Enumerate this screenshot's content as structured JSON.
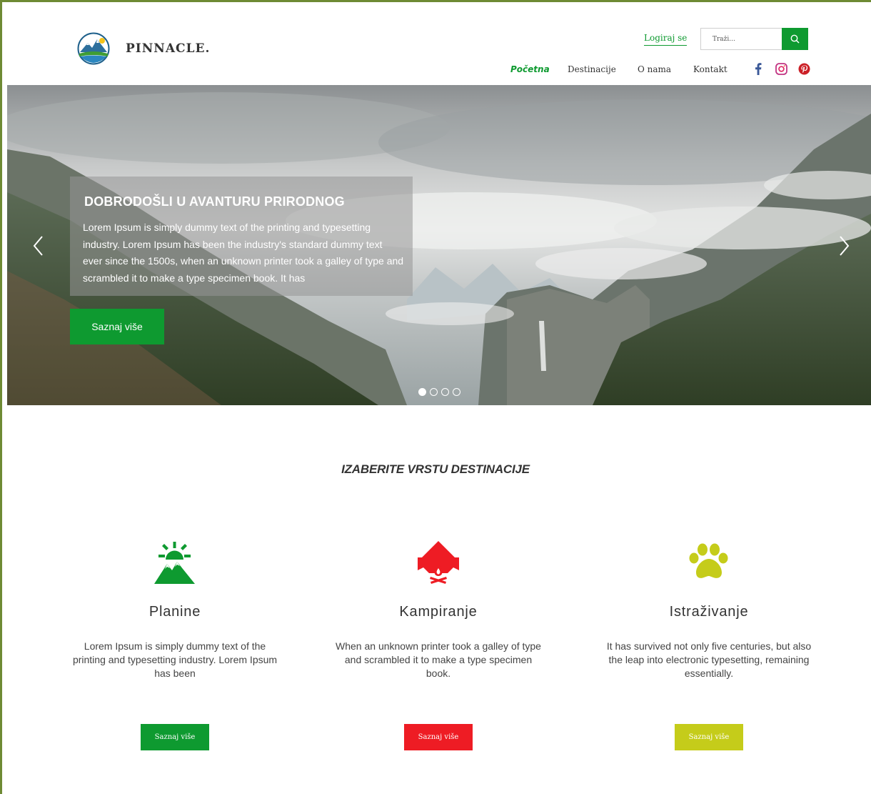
{
  "header": {
    "brand": "PINNACLE.",
    "login_label": "Logiraj se",
    "search_placeholder": "Traži...",
    "nav": [
      "Početna",
      "Destinacije",
      "O nama",
      "Kontakt"
    ],
    "active_nav": "Početna",
    "social_icons": [
      "facebook-icon",
      "instagram-icon",
      "pinterest-icon"
    ]
  },
  "hero": {
    "title": "DOBRODOŠLI U AVANTURU PRIRODNOG",
    "text": "Lorem Ipsum is simply dummy text of the printing and typesetting industry. Lorem Ipsum has been the industry's standard dummy text ever since the 1500s, when an unknown printer took a galley of type and scrambled it to make a type specimen book. It has",
    "button_label": "Saznaj više",
    "slides_count": 4,
    "active_slide": 1
  },
  "section": {
    "title": "IZABERITE VRSTU DESTINACIJE",
    "cards": [
      {
        "title": "Planine",
        "text": "Lorem Ipsum is simply dummy text of the printing and typesetting industry. Lorem Ipsum has been",
        "button_label": "Saznaj više",
        "icon": "mountain-sun-icon",
        "color": "#0e9a30"
      },
      {
        "title": "Kampiranje",
        "text": "When an unknown printer took a galley of type and scrambled it to make a type specimen book.",
        "button_label": "Saznaj više",
        "icon": "tent-campfire-icon",
        "color": "#ee1c24"
      },
      {
        "title": "Istraživanje",
        "text": "It has survived not only five centuries, but also the leap into electronic typesetting, remaining essentially.",
        "button_label": "Saznaj više",
        "icon": "paw-icon",
        "color": "#c5cc1a"
      }
    ]
  },
  "colors": {
    "primary": "#0e9a30",
    "red": "#ee1c24",
    "lime": "#c5cc1a",
    "frame": "#6e8a34"
  }
}
